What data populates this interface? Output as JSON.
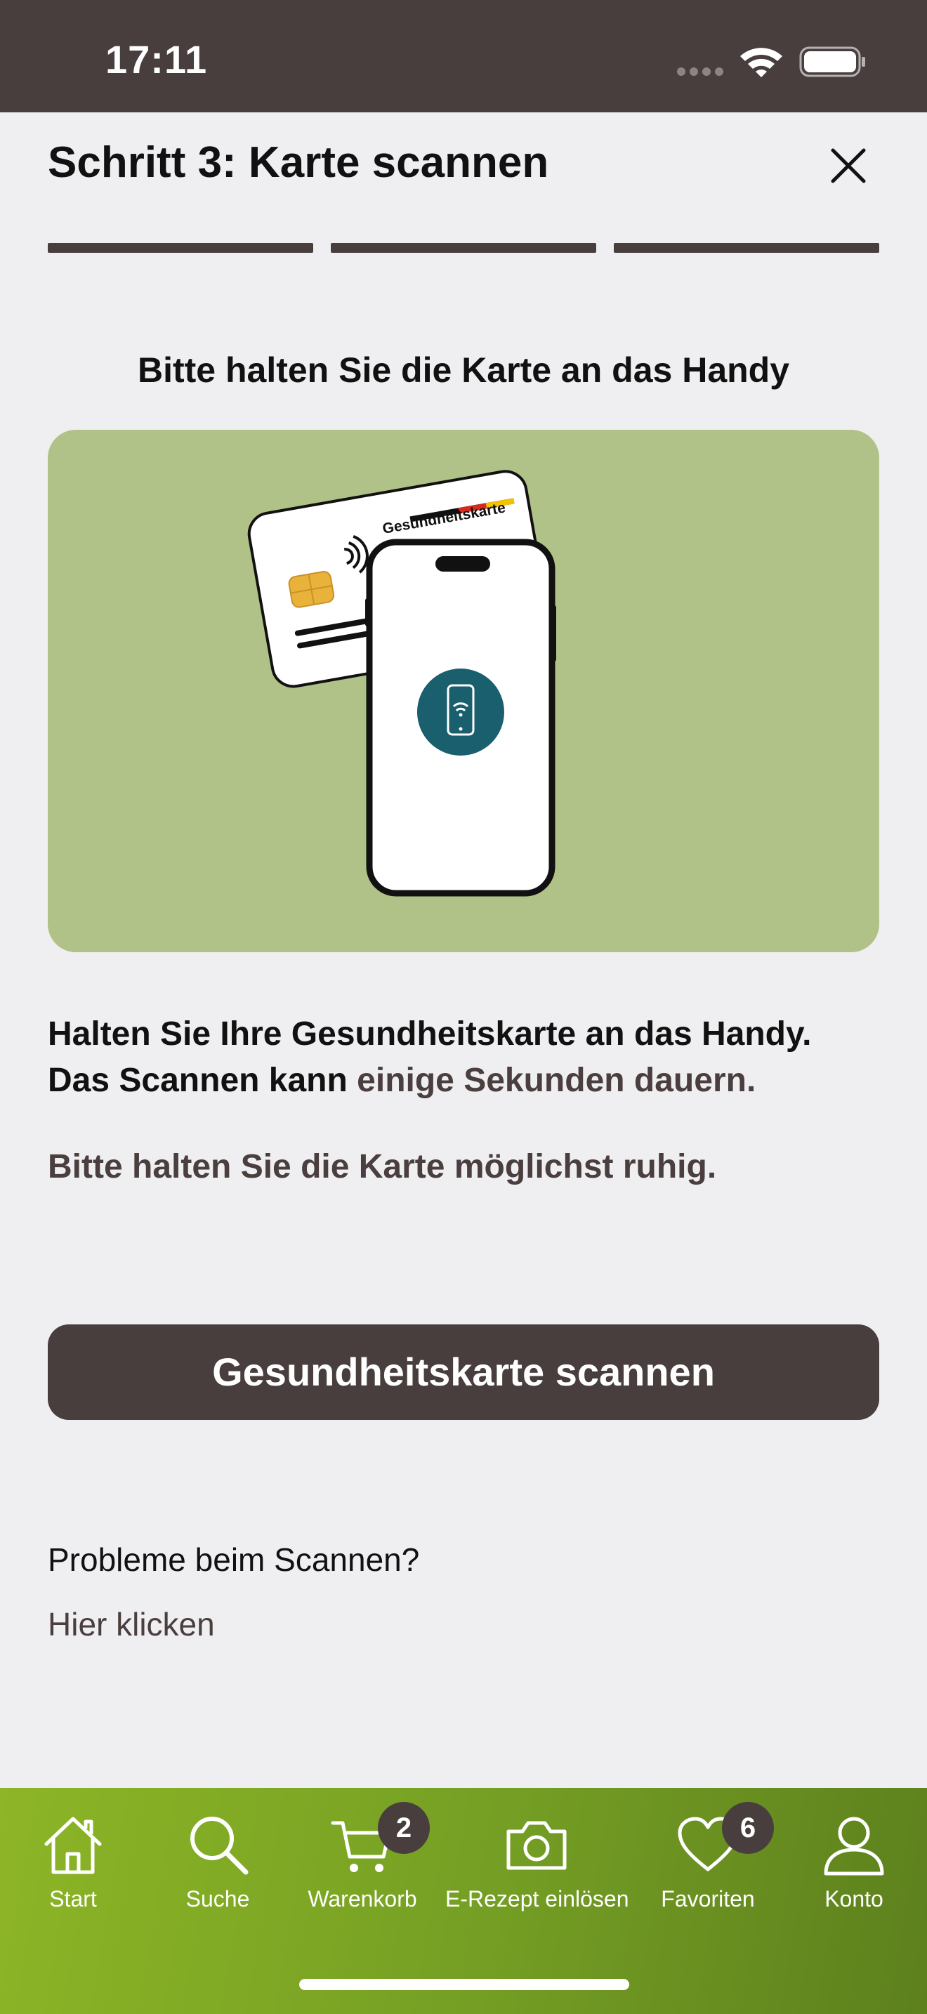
{
  "status_bar": {
    "time": "17:11"
  },
  "header": {
    "title": "Schritt 3: Karte scannen",
    "close_icon": "close-icon"
  },
  "progress": {
    "steps_total": 3,
    "steps_completed": 3
  },
  "instruction": "Bitte halten Sie die Karte an das Handy",
  "illustration": {
    "card_label": "Gesundheitskarte",
    "background_color": "#b0c287",
    "badge_color": "#1a5f6e"
  },
  "body": {
    "line1": "Halten Sie Ihre Gesundheitskarte an das Handy.",
    "line2_start": "Das Scannen kann ",
    "line2_muted": "einige Sekunden dauern.",
    "hint": "Bitte halten Sie die Karte möglichst ruhig."
  },
  "scan_button": {
    "label": "Gesundheitskarte scannen"
  },
  "help": {
    "question": "Probleme beim Scannen?",
    "link": "Hier klicken"
  },
  "tabbar": {
    "items": [
      {
        "label": "Start",
        "icon": "home-icon"
      },
      {
        "label": "Suche",
        "icon": "search-icon"
      },
      {
        "label": "Warenkorb",
        "icon": "cart-icon",
        "badge": "2"
      },
      {
        "label": "E-Rezept einlösen",
        "icon": "camera-icon"
      },
      {
        "label": "Favoriten",
        "icon": "heart-icon",
        "badge": "6"
      },
      {
        "label": "Konto",
        "icon": "user-icon"
      }
    ]
  },
  "colors": {
    "primary": "#493e3e",
    "accent_green": "#8db526",
    "background": "#efeff2"
  }
}
